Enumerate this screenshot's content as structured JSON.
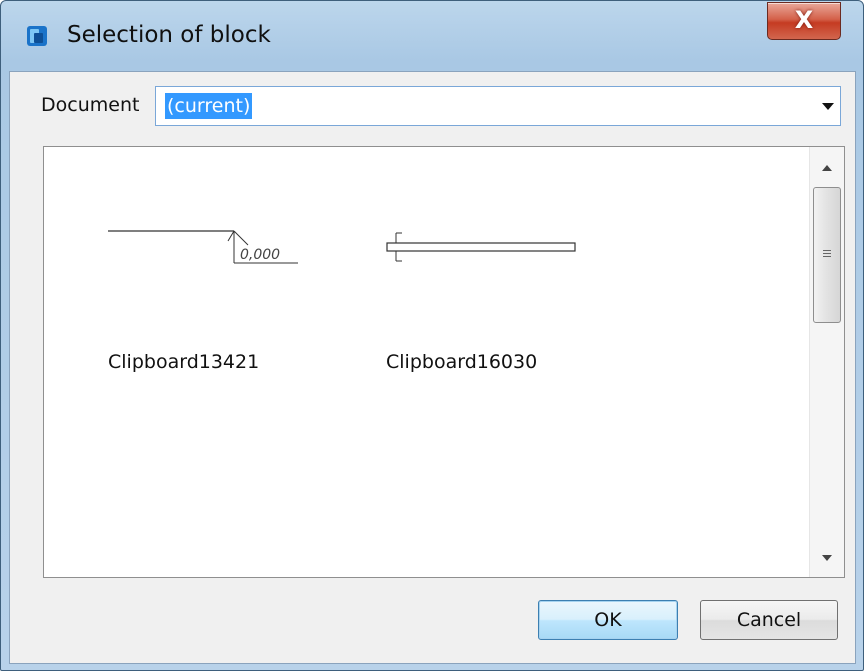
{
  "window": {
    "title": "Selection of block",
    "close_label": "X"
  },
  "document": {
    "label": "Document",
    "selected_value": "(current)"
  },
  "blocks": [
    {
      "name": "Clipboard13421",
      "preview_text": "0,000",
      "preview": "level-mark-icon"
    },
    {
      "name": "Clipboard16030",
      "preview": "beam-section-icon"
    }
  ],
  "buttons": {
    "ok": "OK",
    "cancel": "Cancel"
  }
}
